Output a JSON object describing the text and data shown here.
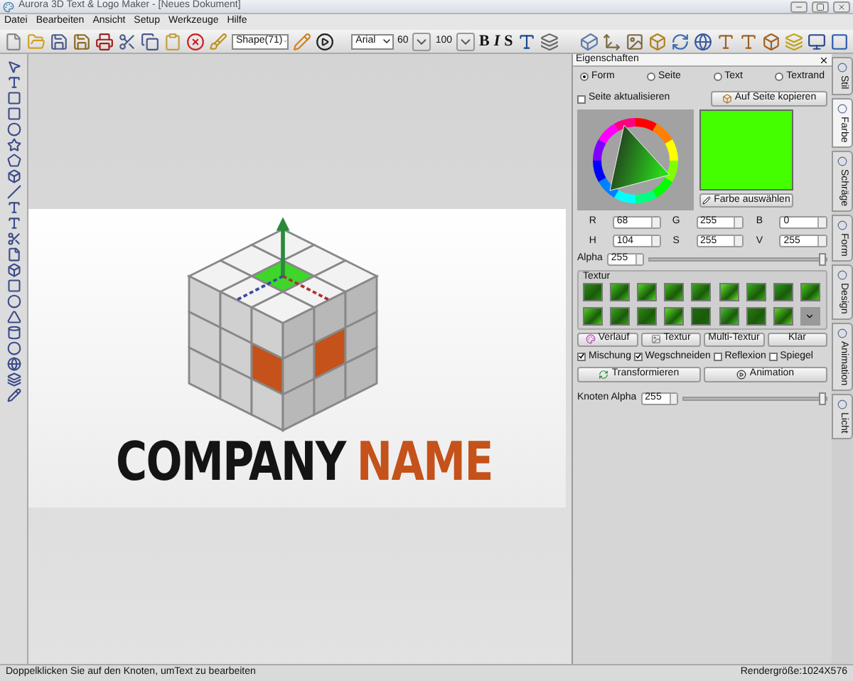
{
  "window": {
    "title": "Aurora 3D Text & Logo Maker - [Neues Dokument]"
  },
  "menu": [
    "Datei",
    "Bearbeiten",
    "Ansicht",
    "Setup",
    "Werkzeuge",
    "Hilfe"
  ],
  "toolbar": {
    "shape_select": "Shape(71)",
    "font_select": "Arial",
    "size_1": "60",
    "size_2": "100",
    "format_buttons": [
      "B",
      "I",
      "S"
    ]
  },
  "canvas": {
    "logo_words": [
      {
        "text": "COMPANY",
        "color": "#141414"
      },
      {
        "text": "NAME",
        "color": "#c4521a"
      }
    ]
  },
  "panel": {
    "title": "Eigenschaften",
    "radios": [
      {
        "label": "Form",
        "selected": true
      },
      {
        "label": "Seite",
        "selected": false
      },
      {
        "label": "Text",
        "selected": false
      },
      {
        "label": "Textrand",
        "selected": false
      }
    ],
    "update_checkbox": {
      "label": "Seite aktualisieren",
      "checked": false
    },
    "copy_button": "Auf Seite kopieren",
    "pick_button": "Farbe auswählen",
    "fields": [
      {
        "label": "R",
        "value": "68"
      },
      {
        "label": "G",
        "value": "255"
      },
      {
        "label": "B",
        "value": "0"
      },
      {
        "label": "H",
        "value": "104"
      },
      {
        "label": "S",
        "value": "255"
      },
      {
        "label": "V",
        "value": "255"
      }
    ],
    "alpha": {
      "label": "Alpha",
      "value": "255",
      "level": 0.98
    },
    "texture": {
      "title": "Textur"
    },
    "fill_buttons": [
      "Verlauf",
      "Textur",
      "Multi-Textur",
      "Klar"
    ],
    "options": [
      {
        "label": "Mischung",
        "checked": true
      },
      {
        "label": "Wegschneiden",
        "checked": true
      },
      {
        "label": "Reflexion",
        "checked": false
      },
      {
        "label": "Spiegel",
        "checked": false
      }
    ],
    "action_buttons": [
      "Transformieren",
      "Animation"
    ],
    "node_alpha": {
      "label": "Knoten Alpha",
      "value": "255",
      "level": 0.98
    }
  },
  "side_tabs": [
    {
      "label": "Stil",
      "selected": false
    },
    {
      "label": "Farbe",
      "selected": true
    },
    {
      "label": "Schräge",
      "selected": false
    },
    {
      "label": "Form",
      "selected": false
    },
    {
      "label": "Design",
      "selected": false
    },
    {
      "label": "Animation",
      "selected": false
    },
    {
      "label": "Licht",
      "selected": false
    }
  ],
  "status_bar": {
    "hint": "Doppelklicken Sie auf den Knoten, umText zu bearbeiten",
    "render_size": "Rendergröße:1024X576"
  }
}
